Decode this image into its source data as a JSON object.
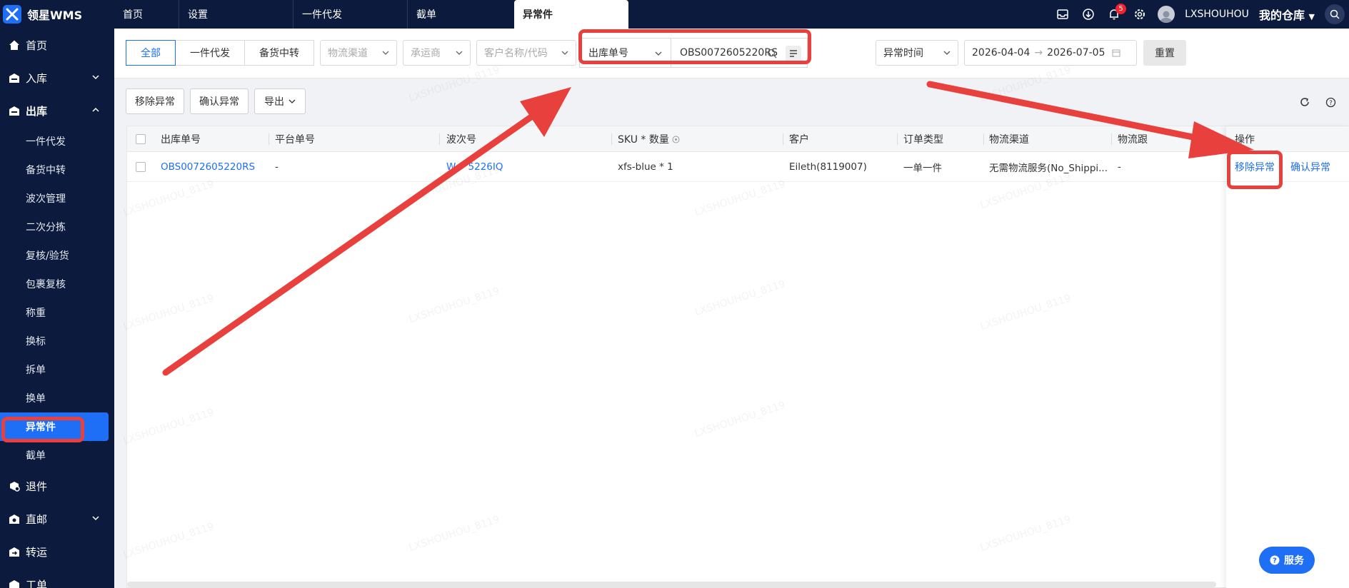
{
  "app": {
    "title": "领星WMS"
  },
  "tabs": [
    {
      "label": "首页"
    },
    {
      "label": "设置"
    },
    {
      "label": "一件代发"
    },
    {
      "label": "截单"
    },
    {
      "label": "异常件"
    }
  ],
  "topbar": {
    "notification_count": "5",
    "username": "LXSHOUHOU",
    "warehouse": "我的仓库"
  },
  "sidebar": {
    "items": [
      {
        "label": "首页"
      },
      {
        "label": "入库"
      },
      {
        "label": "出库"
      },
      {
        "label": "退件"
      },
      {
        "label": "直邮"
      },
      {
        "label": "转运"
      },
      {
        "label": "工单"
      }
    ],
    "outbound_children": [
      {
        "label": "一件代发"
      },
      {
        "label": "备货中转"
      },
      {
        "label": "波次管理"
      },
      {
        "label": "二次分拣"
      },
      {
        "label": "复核/验货"
      },
      {
        "label": "包裹复核"
      },
      {
        "label": "称重"
      },
      {
        "label": "换标"
      },
      {
        "label": "拆单"
      },
      {
        "label": "换单"
      },
      {
        "label": "异常件"
      },
      {
        "label": "截单"
      }
    ]
  },
  "filters": {
    "segments": [
      {
        "label": "全部"
      },
      {
        "label": "一件代发"
      },
      {
        "label": "备货中转"
      }
    ],
    "logistics_channel_placeholder": "物流渠道",
    "carrier_placeholder": "承运商",
    "customer_placeholder": "客户名称/代码",
    "search_type": "出库单号",
    "search_value": "OBS0072605220RS",
    "time_type": "异常时间",
    "date_start": "2026-04-04",
    "date_end": "2026-07-05",
    "reset_label": "重置"
  },
  "toolbar": {
    "remove_label": "移除异常",
    "confirm_label": "确认异常",
    "export_label": "导出"
  },
  "table": {
    "headers": [
      "出库单号",
      "平台单号",
      "波次号",
      "SKU * 数量",
      "客户",
      "订单类型",
      "物流渠道",
      "物流跟",
      "操作"
    ],
    "rows": [
      {
        "outbound_no": "OBS0072605220RS",
        "platform_no": "-",
        "wave_no": "W    5226IQ",
        "sku_qty": "xfs-blue * 1",
        "customer": "Eileth(8119007)",
        "order_type": "一单一件",
        "channel": "无需物流服务(No_Shippi...",
        "tracking": "-",
        "op_remove": "移除异常",
        "op_confirm": "确认异常"
      }
    ]
  },
  "watermark": "LXSHOUHOU_8119",
  "service": {
    "label": "服务"
  },
  "colors": {
    "primary": "#1e6ff5",
    "nav_bg": "#0c1a3d",
    "highlight": "#e8403d"
  }
}
